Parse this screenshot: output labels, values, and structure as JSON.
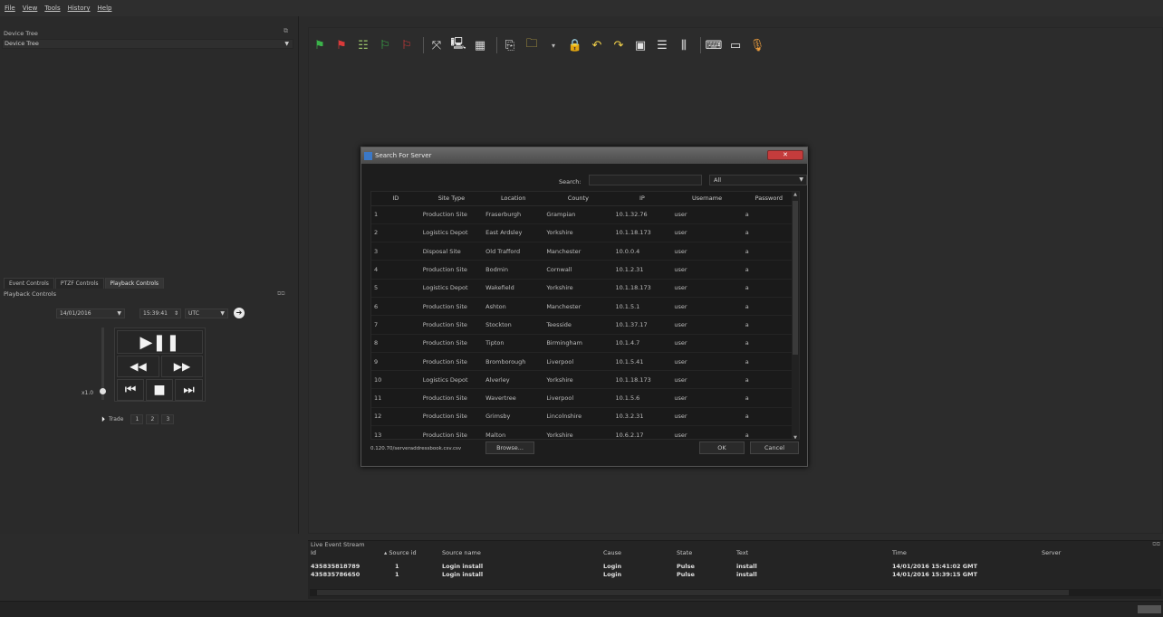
{
  "menu": [
    "File",
    "View",
    "Tools",
    "History",
    "Help"
  ],
  "device_tree": {
    "title": "Device Tree",
    "combo": "Device Tree"
  },
  "tabs": [
    "Event Controls",
    "PTZF Controls",
    "Playback Controls"
  ],
  "playback": {
    "title": "Playback Controls",
    "date": "14/01/2016",
    "time": "15:39:41",
    "timezone": "UTC",
    "speed": "x1.0",
    "trade_label": "Trade",
    "trade_buttons": [
      "1",
      "2",
      "3"
    ]
  },
  "dialog": {
    "title": "Search For Server",
    "search_label": "Search:",
    "search_value": "",
    "filter": "All",
    "columns": [
      "ID",
      "Site Type",
      "Location",
      "County",
      "IP",
      "Username",
      "Password"
    ],
    "rows": [
      [
        "1",
        "Production Site",
        "Fraserburgh",
        "Grampian",
        "10.1.32.76",
        "user",
        "a"
      ],
      [
        "2",
        "Logistics Depot",
        "East Ardsley",
        "Yorkshire",
        "10.1.18.173",
        "user",
        "a"
      ],
      [
        "3",
        "Disposal Site",
        "Old Trafford",
        "Manchester",
        "10.0.0.4",
        "user",
        "a"
      ],
      [
        "4",
        "Production Site",
        "Bodmin",
        "Cornwall",
        "10.1.2.31",
        "user",
        "a"
      ],
      [
        "5",
        "Logistics Depot",
        "Wakefield",
        "Yorkshire",
        "10.1.18.173",
        "user",
        "a"
      ],
      [
        "6",
        "Production Site",
        "Ashton",
        "Manchester",
        "10.1.5.1",
        "user",
        "a"
      ],
      [
        "7",
        "Production Site",
        "Stockton",
        "Teesside",
        "10.1.37.17",
        "user",
        "a"
      ],
      [
        "8",
        "Production Site",
        "Tipton",
        "Birmingham",
        "10.1.4.7",
        "user",
        "a"
      ],
      [
        "9",
        "Production Site",
        "Bromborough",
        "Liverpool",
        "10.1.5.41",
        "user",
        "a"
      ],
      [
        "10",
        "Logistics Depot",
        "Alverley",
        "Yorkshire",
        "10.1.18.173",
        "user",
        "a"
      ],
      [
        "11",
        "Production Site",
        "Wavertree",
        "Liverpool",
        "10.1.5.6",
        "user",
        "a"
      ],
      [
        "12",
        "Production Site",
        "Grimsby",
        "Lincolnshire",
        "10.3.2.31",
        "user",
        "a"
      ],
      [
        "13",
        "Production Site",
        "Malton",
        "Yorkshire",
        "10.6.2.17",
        "user",
        "a"
      ]
    ],
    "path": "0.120.70/serveraddressbook.csv.csv",
    "browse": "Browse...",
    "ok": "OK",
    "cancel": "Cancel"
  },
  "events": {
    "title": "Live Event Stream",
    "columns": [
      "Id",
      "Source id",
      "Source name",
      "Cause",
      "State",
      "Text",
      "Time",
      "Server"
    ],
    "rows": [
      [
        "435835818789",
        "1",
        "Login install",
        "Login",
        "Pulse",
        "install",
        "14/01/2016 15:41:02 GMT",
        ""
      ],
      [
        "435835786650",
        "1",
        "Login install",
        "Login",
        "Pulse",
        "install",
        "14/01/2016 15:39:15 GMT",
        ""
      ]
    ]
  }
}
